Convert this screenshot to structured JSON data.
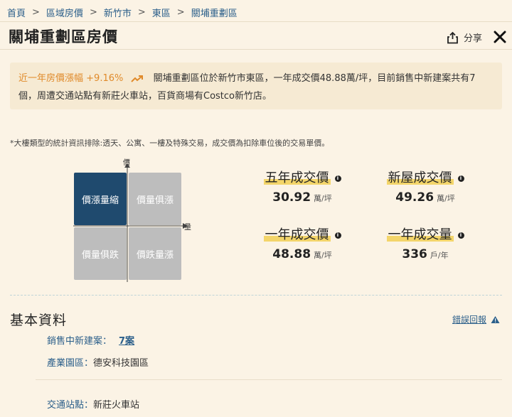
{
  "breadcrumb": {
    "items": [
      "首頁",
      "區域房價",
      "新竹市",
      "東區",
      "關埔重劃區"
    ],
    "separator": ">"
  },
  "header": {
    "title": "關埔重劃區房價",
    "share_label": "分享"
  },
  "summary": {
    "trend_prefix": "近一年房價漲幅",
    "trend_value": "+9.16%",
    "text_line1": "關埔重劃區位於新竹市東區，一年成交價48.88萬/坪，目前銷售中新建案共有7",
    "text_line2": "個，周遭交通站點有新莊火車站，百貨商場有Costco新竹店。"
  },
  "note": "*大樓類型的統計資訊排除:透天、公寓、一樓及特殊交易，成交價為扣除車位後的交易單價。",
  "quadrant": {
    "axis_y": "價",
    "axis_x": "量",
    "cells": [
      "價漲量縮",
      "價量俱漲",
      "價量俱跌",
      "價跌量漲"
    ],
    "active": "價漲量縮"
  },
  "stats": [
    {
      "label": "五年成交價",
      "value": "30.92",
      "unit": "萬/坪"
    },
    {
      "label": "新屋成交價",
      "value": "49.26",
      "unit": "萬/坪"
    },
    {
      "label": "一年成交價",
      "value": "48.88",
      "unit": "萬/坪"
    },
    {
      "label": "一年成交量",
      "value": "336",
      "unit": "戶/年"
    }
  ],
  "basic": {
    "title": "基本資料",
    "report_label": "錯誤回報",
    "rows": [
      {
        "key": "銷售中新建案：",
        "value": "7案"
      },
      {
        "key": "產業園區：",
        "value": "德安科技園區"
      },
      {
        "key": "交通站點：",
        "value": "新莊火車站"
      }
    ]
  },
  "colors": {
    "accent": "#2b5f8a",
    "active_quadrant": "#1f4a6e",
    "trend": "#e08a2a",
    "highlight": "#f3d56a"
  }
}
